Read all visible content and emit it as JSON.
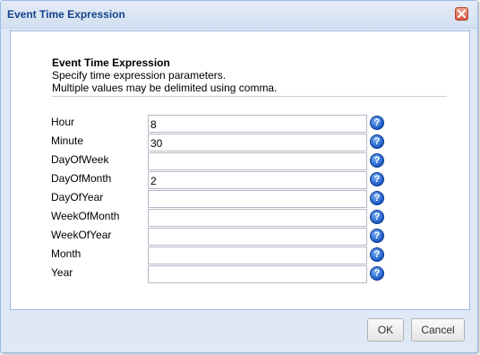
{
  "dialog": {
    "title": "Event Time Expression",
    "close_icon": "close-icon",
    "header": "Event Time Expression",
    "description_line1": "Specify time expression parameters.",
    "description_line2": "Multiple values may be delimited using comma.",
    "help_icon": "help-icon",
    "fields": [
      {
        "label": "Hour",
        "value": "8"
      },
      {
        "label": "Minute",
        "value": "30"
      },
      {
        "label": "DayOfWeek",
        "value": ""
      },
      {
        "label": "DayOfMonth",
        "value": "2"
      },
      {
        "label": "DayOfYear",
        "value": ""
      },
      {
        "label": "WeekOfMonth",
        "value": ""
      },
      {
        "label": "WeekOfYear",
        "value": ""
      },
      {
        "label": "Month",
        "value": ""
      },
      {
        "label": "Year",
        "value": ""
      }
    ],
    "ok_label": "OK",
    "cancel_label": "Cancel"
  }
}
